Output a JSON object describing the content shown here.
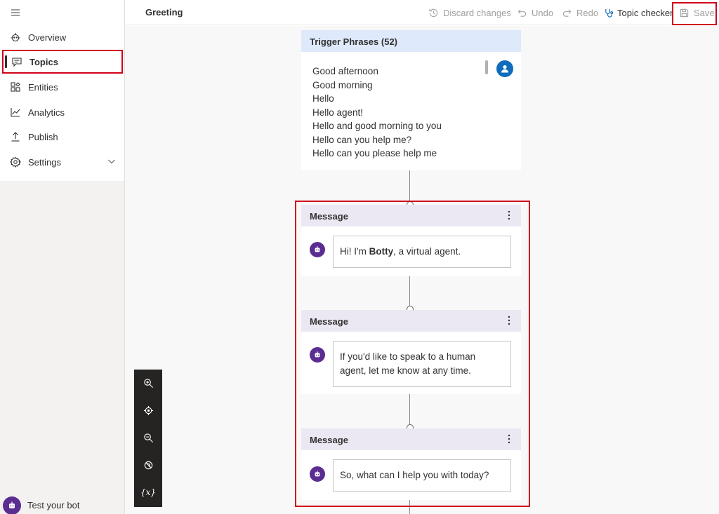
{
  "sidebar": {
    "items": [
      {
        "label": "Overview",
        "icon": "bot-outline-icon"
      },
      {
        "label": "Topics",
        "icon": "chat-icon",
        "active": true
      },
      {
        "label": "Entities",
        "icon": "entities-icon"
      },
      {
        "label": "Analytics",
        "icon": "chart-line-icon"
      },
      {
        "label": "Publish",
        "icon": "upload-icon"
      },
      {
        "label": "Settings",
        "icon": "gear-icon",
        "expandable": true
      }
    ],
    "test_bot_label": "Test your bot"
  },
  "header": {
    "title": "Greeting",
    "discard_label": "Discard changes",
    "undo_label": "Undo",
    "redo_label": "Redo",
    "topic_checker_label": "Topic checker",
    "save_label": "Save"
  },
  "trigger": {
    "title": "Trigger Phrases (52)",
    "phrases": [
      "Good afternoon",
      "Good morning",
      "Hello",
      "Hello agent!",
      "Hello and good morning to you",
      "Hello can you help me?",
      "Hello can you please help me"
    ]
  },
  "messages": [
    {
      "title": "Message",
      "text_before": "Hi! I'm ",
      "text_bold": "Botty",
      "text_after": ", a virtual agent."
    },
    {
      "title": "Message",
      "text_line1": "If you'd like to speak to a human",
      "text_line2": "agent, let me know at any time."
    },
    {
      "title": "Message",
      "text": "So, what can I help you with today?"
    }
  ],
  "zoom_toolbar": {
    "variables_label": "{x}"
  },
  "colors": {
    "accent_purple": "#5c2d91",
    "highlight_red": "#d0021b",
    "trigger_header": "#dee9fb",
    "message_header": "#ebe8f3",
    "user_avatar_blue": "#0f6cbd"
  }
}
